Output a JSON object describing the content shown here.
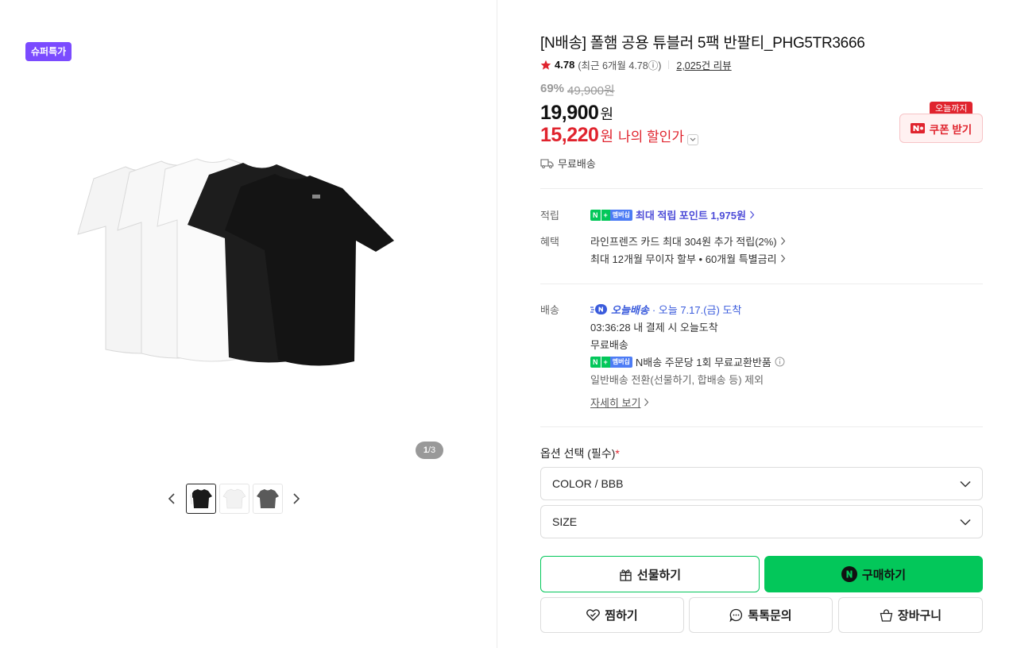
{
  "gallery": {
    "badge": "슈퍼특가",
    "page_current": "1",
    "page_total": "/3"
  },
  "product": {
    "title": "[N배송] 폴햄 공용 튜블러 5팩 반팔티_PHG5TR3666",
    "rating": "4.78",
    "recent_rating": "(최근 6개월 4.78ⓘ)",
    "review_count": "2,025건 리뷰",
    "discount_pct": "69%",
    "original_price": "49,900원",
    "price": "19,900",
    "price_unit": "원",
    "my_price": "15,220",
    "my_price_unit": "원",
    "my_price_label": "나의 할인가",
    "free_shipping": "무료배송"
  },
  "coupon": {
    "tag": "오늘까지",
    "label": "쿠폰 받기"
  },
  "npay_badge": {
    "n": "N",
    "plus": "+",
    "membership": "멤버십"
  },
  "benefits": {
    "points_label": "적립",
    "points_text": "최대 적립 포인트 1,975원",
    "benefit_label": "혜택",
    "benefit_line1": "라인프렌즈 카드 최대 304원 추가 적립(2%)",
    "benefit_line2": "최대 12개월 무이자 할부 • 60개월 특별금리"
  },
  "delivery": {
    "label": "배송",
    "today_brand": "오늘배송",
    "today_date": "· 오늘 7.17.(금) 도착",
    "countdown": "03:36:28  내 결제 시 오늘도착",
    "fee": "무료배송",
    "exchange": "N배송 주문당 1회 무료교환반품",
    "exclude": "일반배송 전환(선물하기, 합배송 등) 제외",
    "detail_link": "자세히 보기"
  },
  "options": {
    "label": "옵션 선택 (필수)",
    "required_mark": "*",
    "color": "COLOR / BBB",
    "size": "SIZE"
  },
  "actions": {
    "gift": "선물하기",
    "buy": "구매하기",
    "wish": "찜하기",
    "talk": "톡톡문의",
    "cart": "장바구니"
  },
  "colors": {
    "accent_green": "#03c75a",
    "sale_red": "#e0242e",
    "super_purple": "#7b4bff"
  },
  "icons": [
    "star-icon",
    "truck-icon",
    "chevron-right-icon",
    "chevron-down-icon",
    "info-icon",
    "gift-icon",
    "naver-n-icon",
    "heart-icon",
    "chat-icon",
    "cart-icon",
    "chevron-left-icon"
  ]
}
